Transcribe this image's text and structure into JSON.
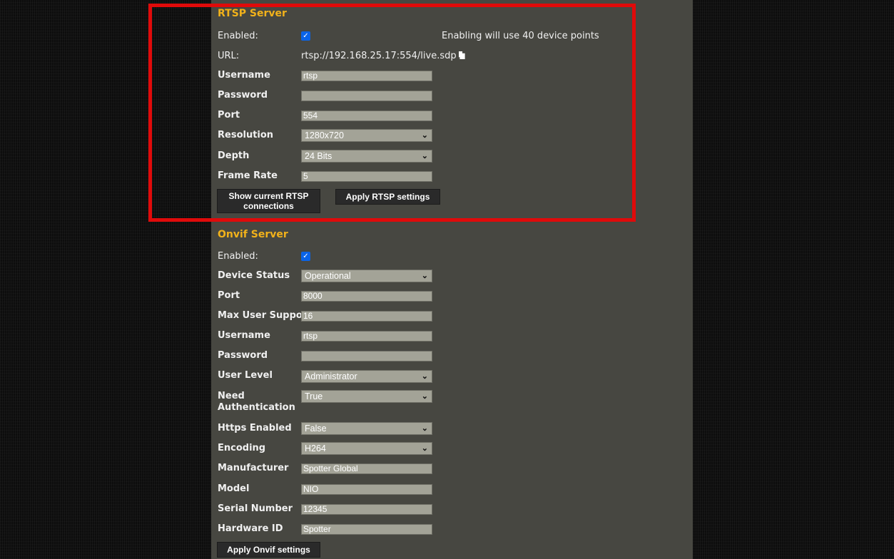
{
  "rtsp": {
    "title": "RTSP Server",
    "enabled_label": "Enabled:",
    "enabled_note": "Enabling will use 40 device points",
    "url_label": "URL:",
    "url_value": "rtsp://192.168.25.17:554/live.sdp",
    "username_label": "Username",
    "username_value": "rtsp",
    "password_label": "Password",
    "password_value": "",
    "port_label": "Port",
    "port_value": "554",
    "resolution_label": "Resolution",
    "resolution_value": "1280x720",
    "depth_label": "Depth",
    "depth_value": "24 Bits",
    "framerate_label": "Frame Rate",
    "framerate_value": "5",
    "show_connections_line1": "Show current RTSP",
    "show_connections_line2": "connections",
    "apply_label": "Apply RTSP settings"
  },
  "onvif": {
    "title": "Onvif Server",
    "enabled_label": "Enabled:",
    "device_status_label": "Device Status",
    "device_status_value": "Operational",
    "port_label": "Port",
    "port_value": "8000",
    "max_user_label": "Max User Support",
    "max_user_value": "16",
    "username_label": "Username",
    "username_value": "rtsp",
    "password_label": "Password",
    "password_value": "",
    "user_level_label": "User Level",
    "user_level_value": "Administrator",
    "need_auth_line1": "Need",
    "need_auth_line2": "Authentication",
    "need_auth_value": "True",
    "https_label": "Https Enabled",
    "https_value": "False",
    "encoding_label": "Encoding",
    "encoding_value": "H264",
    "manufacturer_label": "Manufacturer",
    "manufacturer_value": "Spotter Global",
    "model_label": "Model",
    "model_value": "NIO",
    "serial_label": "Serial Number",
    "serial_value": "12345",
    "hardware_label": "Hardware ID",
    "hardware_value": "Spotter",
    "apply_label": "Apply Onvif settings"
  },
  "icons": {
    "checkbox": "checkmark-icon",
    "copy": "copy-icon",
    "dropdown": "chevron-down-icon"
  },
  "colors": {
    "panel": "#474741",
    "section_title": "#f2b21a",
    "highlight": "#e00a0a",
    "checkbox": "#0a64e8"
  }
}
